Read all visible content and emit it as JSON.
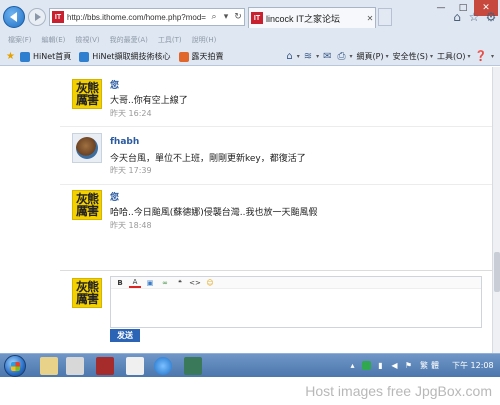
{
  "browser": {
    "url": "http://bbs.ithome.com/home.php?mod=",
    "site_badge": "IT",
    "tab_title": "lincock IT之家论坛",
    "menu": [
      "檔案(F)",
      "編輯(E)",
      "檢視(V)",
      "我的最愛(A)",
      "工具(T)",
      "說明(H)"
    ],
    "favorites": [
      "HiNet首頁",
      "HiNet擷取網技術核心",
      "露天拍賣"
    ],
    "commands": [
      "網頁(P)",
      "安全性(S)",
      "工具(O)"
    ],
    "icons": {
      "back": "back-arrow-icon",
      "forward": "forward-arrow-icon",
      "home": "home-icon",
      "favorites": "star-icon",
      "settings": "gear-icon",
      "smiley": "smiley-icon"
    },
    "window_controls": [
      "—",
      "□",
      "✕"
    ]
  },
  "messages": [
    {
      "user": "您",
      "text": "大哥..你有空上線了",
      "time": "昨天 16:24",
      "avatar": "bear-logo"
    },
    {
      "user": "fhabh",
      "text": "今天台風，單位不上班，剛剛更新key，都復活了",
      "time": "昨天 17:39",
      "avatar": "photo"
    },
    {
      "user": "您",
      "text": "哈哈..今日颱風(蘇德娜)侵襲台灣..我也放一天颱風假",
      "time": "昨天 18:48",
      "avatar": "bear-logo"
    }
  ],
  "avatar_chars": [
    "灰",
    "熊",
    "厲",
    "害"
  ],
  "editor": {
    "toolbar": [
      "B",
      "A",
      "▣",
      "∞",
      "❝",
      "<>",
      "☺"
    ],
    "send_label": "发送"
  },
  "taskbar": {
    "ime": "繁",
    "lang": "體",
    "clock": "下午 12:08"
  },
  "watermark": "Host images free JpgBox.com",
  "colors": {
    "username": "#2a5aa0",
    "send_button": "#2b63b5",
    "avatar_yellow": "#f3d000",
    "taskbar": "#4c77ad"
  }
}
